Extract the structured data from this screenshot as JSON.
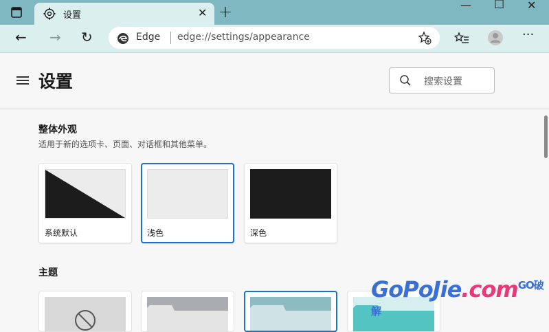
{
  "window": {
    "tab_title": "设置",
    "close_tab_glyph": "✕",
    "new_tab_glyph": "+",
    "minimize_glyph": "—",
    "maximize_glyph": "☐",
    "close_glyph": "✕"
  },
  "nav": {
    "back_glyph": "←",
    "forward_glyph": "→",
    "refresh_glyph": "↻",
    "site_label": "Edge",
    "url": "edge://settings/appearance",
    "more_glyph": "···"
  },
  "header": {
    "title": "设置",
    "search_placeholder": "搜索设置"
  },
  "appearance": {
    "title": "整体外观",
    "description": "适用于新的选项卡、页面、对话框和其他菜单。",
    "options": [
      {
        "label": "系统默认",
        "selected": false
      },
      {
        "label": "浅色",
        "selected": true
      },
      {
        "label": "深色",
        "selected": false
      }
    ]
  },
  "themes": {
    "title": "主题"
  },
  "watermark": {
    "text_a": "GoPoJie",
    "text_b": ".com",
    "text_small": "GO破解"
  },
  "colors": {
    "titlebar": "#7fb8c1",
    "toolbar": "#dcefef",
    "accent": "#1a73c8",
    "dark_preview": "#1c1c1c",
    "light_preview": "#ececec"
  }
}
